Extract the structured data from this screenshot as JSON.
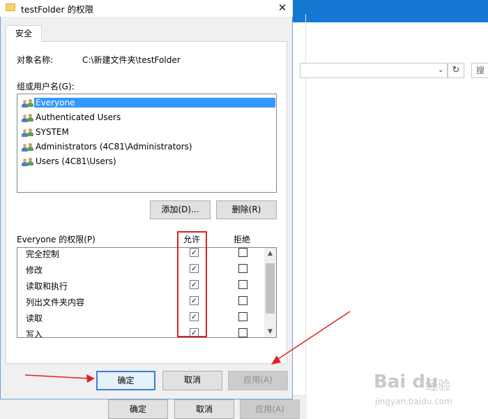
{
  "dialog": {
    "title": "testFolder 的权限",
    "close_glyph": "✕",
    "tab": "安全",
    "object_label": "对象名称:",
    "object_value": "C:\\新建文件夹\\testFolder",
    "group_label": "组或用户名(G):",
    "users": [
      {
        "name": "Everyone",
        "selected": true
      },
      {
        "name": "Authenticated Users",
        "selected": false
      },
      {
        "name": "SYSTEM",
        "selected": false
      },
      {
        "name": "Administrators (4C81\\Administrators)",
        "selected": false
      },
      {
        "name": "Users (4C81\\Users)",
        "selected": false
      }
    ],
    "add_button": "添加(D)...",
    "remove_button": "删除(R)",
    "permissions_label": "Everyone 的权限(P)",
    "allow_header": "允许",
    "deny_header": "拒绝",
    "permissions": [
      {
        "name": "完全控制",
        "allow": true,
        "deny": false
      },
      {
        "name": "修改",
        "allow": true,
        "deny": false
      },
      {
        "name": "读取和执行",
        "allow": true,
        "deny": false
      },
      {
        "name": "列出文件夹内容",
        "allow": true,
        "deny": false
      },
      {
        "name": "读取",
        "allow": true,
        "deny": false
      },
      {
        "name": "写入",
        "allow": true,
        "deny": false
      }
    ],
    "ok_button": "确定",
    "cancel_button": "取消",
    "apply_button": "应用(A)"
  },
  "background": {
    "search_placeholder": "搜",
    "refresh_glyph": "↻",
    "dropdown_glyph": "⌄",
    "ok_button": "确定",
    "cancel_button": "取消",
    "apply_button": "应用(A)"
  },
  "watermark": {
    "logo": "Bai du",
    "jingyan": "经验",
    "url": "jingyan.baidu.com"
  },
  "colors": {
    "accent": "#3399ff",
    "title_bar": "#1478d2",
    "annotation": "#e02020"
  },
  "icons": {
    "title_icon": "folder-icon",
    "user_icon": "user-group-icon",
    "check": "☑"
  }
}
